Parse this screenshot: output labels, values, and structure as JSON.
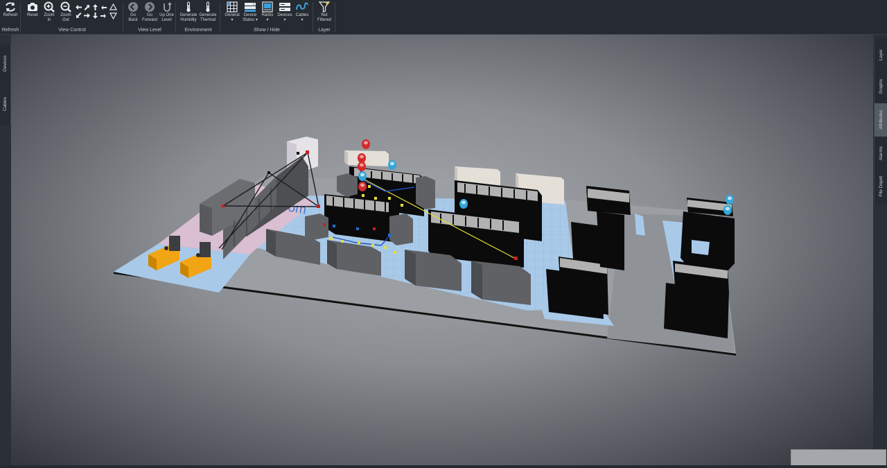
{
  "ribbon": {
    "refresh": {
      "label": "Refresh",
      "group": "Refresh"
    },
    "view_control": {
      "group": "View Control",
      "reset": "Reset",
      "zoom_in": "Zoom\nIn",
      "zoom_out": "Zoom\nOut"
    },
    "view_level": {
      "group": "View Level",
      "go_back": "Go\nBack",
      "go_forward": "Go\nForward",
      "up_one_level": "Up One\nLevel"
    },
    "environment": {
      "group": "Environment",
      "humidity": "Generate\nHumidity",
      "thermal": "Generate\nThermal"
    },
    "show_hide": {
      "group": "Show / Hide",
      "general": "General\n▾",
      "device_status": "Device\nStatus ▾",
      "racks": "Racks\n▾",
      "devices": "Devices\n▾",
      "cables": "Cables\n▾"
    },
    "layer": {
      "group": "Layer",
      "not_filtered": "Not\nFiltered"
    }
  },
  "left_tabs": [
    "Devices",
    "Cables"
  ],
  "right_tabs": [
    "Layer",
    "Graphs",
    "Attributes",
    "Alarms",
    "File Depot"
  ],
  "active_right_tab": "Attributes",
  "scene": {
    "room_label": "Room",
    "colors": {
      "floor_blue": "#a9c9e8",
      "floor_pink": "#d9bfd1",
      "rack_black": "#0b0b0c",
      "cabinet_gray": "#5f6165",
      "generator_yellow": "#f1a514",
      "alarm_red": "#d42a2a",
      "status_blue": "#35a6d8",
      "cable_yellow": "#e6df3a"
    }
  }
}
